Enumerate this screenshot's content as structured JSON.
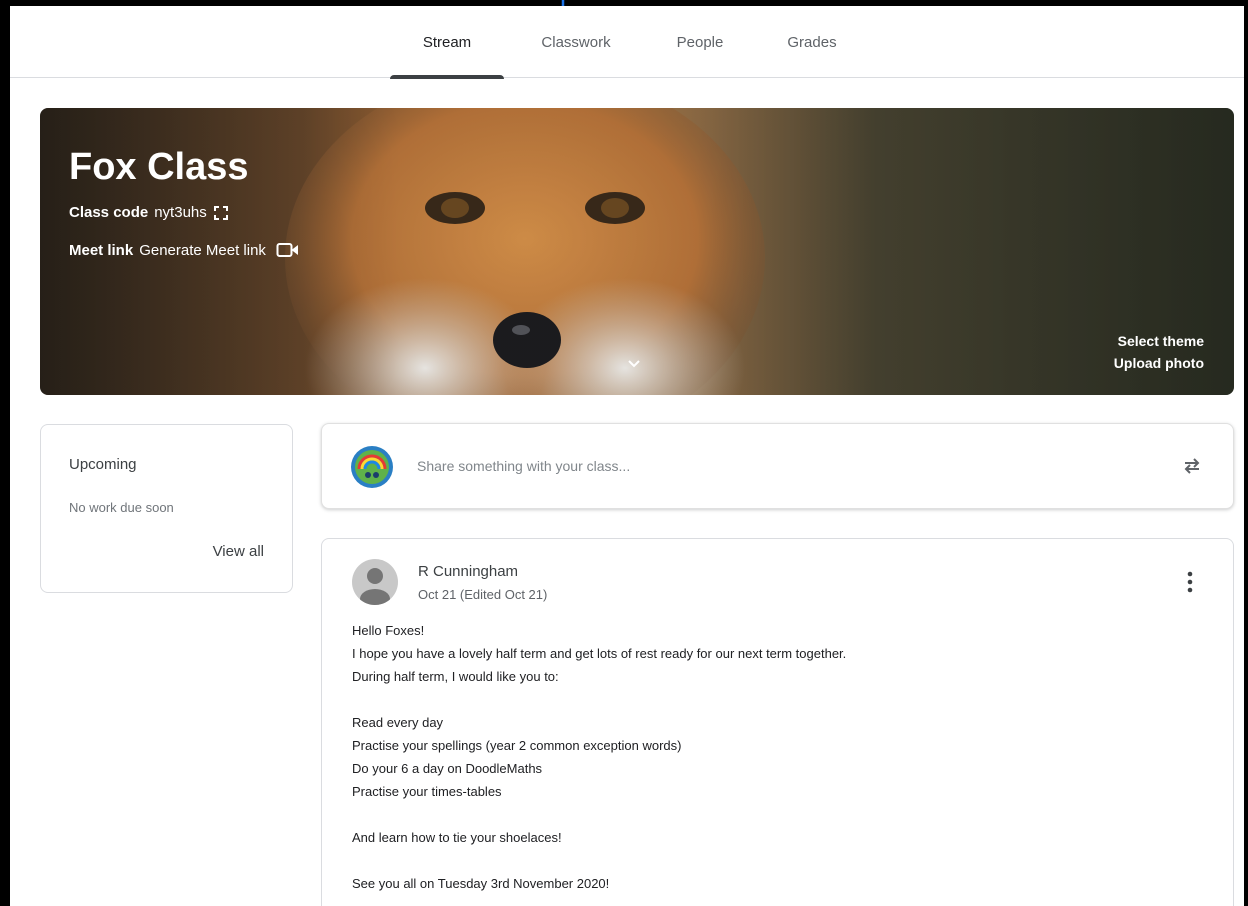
{
  "nav": {
    "tabs": [
      {
        "label": "Stream",
        "active": true
      },
      {
        "label": "Classwork",
        "active": false
      },
      {
        "label": "People",
        "active": false
      },
      {
        "label": "Grades",
        "active": false
      }
    ]
  },
  "banner": {
    "title": "Fox Class",
    "class_code_label": "Class code",
    "class_code_value": "nyt3uhs",
    "meet_label": "Meet link",
    "meet_value": "Generate Meet link",
    "select_theme": "Select theme",
    "upload_photo": "Upload photo"
  },
  "upcoming": {
    "title": "Upcoming",
    "empty_text": "No work due soon",
    "view_all": "View all"
  },
  "share": {
    "placeholder": "Share something with your class..."
  },
  "post": {
    "author": "R Cunningham",
    "date": "Oct 21 (Edited Oct 21)",
    "lines": [
      "Hello Foxes!",
      "I hope you have a lovely half term and get lots of rest ready for our next term together.",
      "During half term, I would like you to:",
      "",
      "Read every day",
      "Practise your spellings (year 2 common exception words)",
      "Do your 6 a day on DoodleMaths",
      "Practise your times-tables",
      "",
      "And learn how to tie your shoelaces!",
      "",
      "See you all on Tuesday 3rd November 2020!"
    ]
  },
  "colors": {
    "arrow": "#1a73e8",
    "active_tab_indicator": "#3c4043"
  },
  "icons": {
    "copy_code": "fullscreen-corners-icon",
    "meet": "video-camera-icon",
    "expand": "chevron-down-icon",
    "repost": "repost-icon",
    "more": "more-vert-icon",
    "user": "person-avatar-icon"
  }
}
